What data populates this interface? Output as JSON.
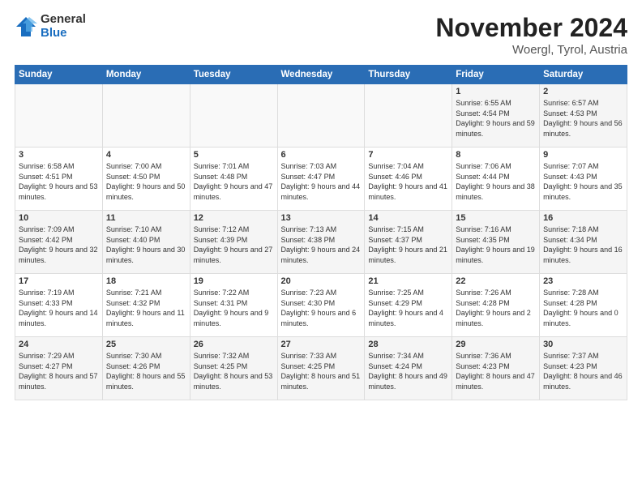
{
  "header": {
    "logo_general": "General",
    "logo_blue": "Blue",
    "title": "November 2024",
    "location": "Woergl, Tyrol, Austria"
  },
  "days_of_week": [
    "Sunday",
    "Monday",
    "Tuesday",
    "Wednesday",
    "Thursday",
    "Friday",
    "Saturday"
  ],
  "weeks": [
    [
      {
        "day": "",
        "info": ""
      },
      {
        "day": "",
        "info": ""
      },
      {
        "day": "",
        "info": ""
      },
      {
        "day": "",
        "info": ""
      },
      {
        "day": "",
        "info": ""
      },
      {
        "day": "1",
        "info": "Sunrise: 6:55 AM\nSunset: 4:54 PM\nDaylight: 9 hours and 59 minutes."
      },
      {
        "day": "2",
        "info": "Sunrise: 6:57 AM\nSunset: 4:53 PM\nDaylight: 9 hours and 56 minutes."
      }
    ],
    [
      {
        "day": "3",
        "info": "Sunrise: 6:58 AM\nSunset: 4:51 PM\nDaylight: 9 hours and 53 minutes."
      },
      {
        "day": "4",
        "info": "Sunrise: 7:00 AM\nSunset: 4:50 PM\nDaylight: 9 hours and 50 minutes."
      },
      {
        "day": "5",
        "info": "Sunrise: 7:01 AM\nSunset: 4:48 PM\nDaylight: 9 hours and 47 minutes."
      },
      {
        "day": "6",
        "info": "Sunrise: 7:03 AM\nSunset: 4:47 PM\nDaylight: 9 hours and 44 minutes."
      },
      {
        "day": "7",
        "info": "Sunrise: 7:04 AM\nSunset: 4:46 PM\nDaylight: 9 hours and 41 minutes."
      },
      {
        "day": "8",
        "info": "Sunrise: 7:06 AM\nSunset: 4:44 PM\nDaylight: 9 hours and 38 minutes."
      },
      {
        "day": "9",
        "info": "Sunrise: 7:07 AM\nSunset: 4:43 PM\nDaylight: 9 hours and 35 minutes."
      }
    ],
    [
      {
        "day": "10",
        "info": "Sunrise: 7:09 AM\nSunset: 4:42 PM\nDaylight: 9 hours and 32 minutes."
      },
      {
        "day": "11",
        "info": "Sunrise: 7:10 AM\nSunset: 4:40 PM\nDaylight: 9 hours and 30 minutes."
      },
      {
        "day": "12",
        "info": "Sunrise: 7:12 AM\nSunset: 4:39 PM\nDaylight: 9 hours and 27 minutes."
      },
      {
        "day": "13",
        "info": "Sunrise: 7:13 AM\nSunset: 4:38 PM\nDaylight: 9 hours and 24 minutes."
      },
      {
        "day": "14",
        "info": "Sunrise: 7:15 AM\nSunset: 4:37 PM\nDaylight: 9 hours and 21 minutes."
      },
      {
        "day": "15",
        "info": "Sunrise: 7:16 AM\nSunset: 4:35 PM\nDaylight: 9 hours and 19 minutes."
      },
      {
        "day": "16",
        "info": "Sunrise: 7:18 AM\nSunset: 4:34 PM\nDaylight: 9 hours and 16 minutes."
      }
    ],
    [
      {
        "day": "17",
        "info": "Sunrise: 7:19 AM\nSunset: 4:33 PM\nDaylight: 9 hours and 14 minutes."
      },
      {
        "day": "18",
        "info": "Sunrise: 7:21 AM\nSunset: 4:32 PM\nDaylight: 9 hours and 11 minutes."
      },
      {
        "day": "19",
        "info": "Sunrise: 7:22 AM\nSunset: 4:31 PM\nDaylight: 9 hours and 9 minutes."
      },
      {
        "day": "20",
        "info": "Sunrise: 7:23 AM\nSunset: 4:30 PM\nDaylight: 9 hours and 6 minutes."
      },
      {
        "day": "21",
        "info": "Sunrise: 7:25 AM\nSunset: 4:29 PM\nDaylight: 9 hours and 4 minutes."
      },
      {
        "day": "22",
        "info": "Sunrise: 7:26 AM\nSunset: 4:28 PM\nDaylight: 9 hours and 2 minutes."
      },
      {
        "day": "23",
        "info": "Sunrise: 7:28 AM\nSunset: 4:28 PM\nDaylight: 9 hours and 0 minutes."
      }
    ],
    [
      {
        "day": "24",
        "info": "Sunrise: 7:29 AM\nSunset: 4:27 PM\nDaylight: 8 hours and 57 minutes."
      },
      {
        "day": "25",
        "info": "Sunrise: 7:30 AM\nSunset: 4:26 PM\nDaylight: 8 hours and 55 minutes."
      },
      {
        "day": "26",
        "info": "Sunrise: 7:32 AM\nSunset: 4:25 PM\nDaylight: 8 hours and 53 minutes."
      },
      {
        "day": "27",
        "info": "Sunrise: 7:33 AM\nSunset: 4:25 PM\nDaylight: 8 hours and 51 minutes."
      },
      {
        "day": "28",
        "info": "Sunrise: 7:34 AM\nSunset: 4:24 PM\nDaylight: 8 hours and 49 minutes."
      },
      {
        "day": "29",
        "info": "Sunrise: 7:36 AM\nSunset: 4:23 PM\nDaylight: 8 hours and 47 minutes."
      },
      {
        "day": "30",
        "info": "Sunrise: 7:37 AM\nSunset: 4:23 PM\nDaylight: 8 hours and 46 minutes."
      }
    ]
  ]
}
